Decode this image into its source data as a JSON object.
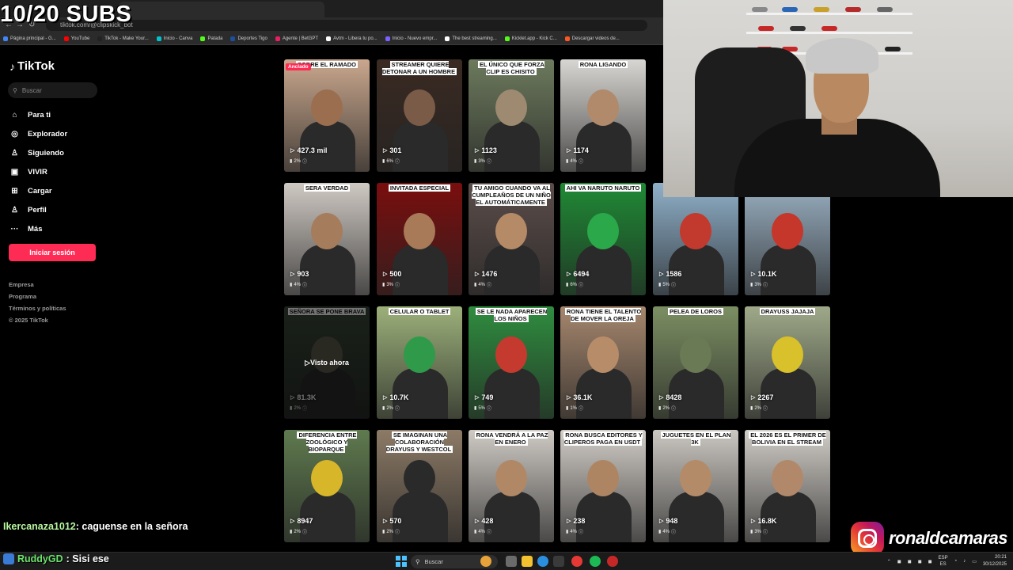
{
  "overlay": {
    "subs": "10/20 SUBS"
  },
  "browser": {
    "url": "tiktok.com/@clipskick_bot",
    "bookmarks": [
      {
        "label": "Página principal - G...",
        "color": "#4285f4"
      },
      {
        "label": "YouTube",
        "color": "#ff0000"
      },
      {
        "label": "TikTok - Make Your...",
        "color": "#222222"
      },
      {
        "label": "Inicio - Canva",
        "color": "#00c4cc"
      },
      {
        "label": "Patada",
        "color": "#53fc18"
      },
      {
        "label": "Deportes Tigo",
        "color": "#1b4fa0"
      },
      {
        "label": "Agente | BetGPT",
        "color": "#e91e63"
      },
      {
        "label": "Avtm - Libera tu po...",
        "color": "#ffffff"
      },
      {
        "label": "Inicio - Nuevo empr...",
        "color": "#7b61ff"
      },
      {
        "label": "The best streaming...",
        "color": "#ffffff"
      },
      {
        "label": "Kicklet.app - Kick C...",
        "color": "#53fc18"
      },
      {
        "label": "Descargar videos de...",
        "color": "#ff5722"
      }
    ]
  },
  "sidebar": {
    "logo": "TikTok",
    "search_placeholder": "Buscar",
    "nav": [
      {
        "label": "Para ti",
        "icon": "home-icon",
        "glyph": "⌂"
      },
      {
        "label": "Explorador",
        "icon": "compass-icon",
        "glyph": "◎"
      },
      {
        "label": "Siguiendo",
        "icon": "user-follow-icon",
        "glyph": "♙"
      },
      {
        "label": "VIVIR",
        "icon": "live-icon",
        "glyph": "▣"
      },
      {
        "label": "Cargar",
        "icon": "upload-icon",
        "glyph": "⊞"
      },
      {
        "label": "Perfil",
        "icon": "profile-icon",
        "glyph": "♙"
      },
      {
        "label": "Más",
        "icon": "more-icon",
        "glyph": "···"
      }
    ],
    "login_label": "Iniciar sesión",
    "footer": [
      "Empresa",
      "Programa",
      "Términos y políticas",
      "© 2025 TikTok"
    ]
  },
  "videos": [
    {
      "caption": "SOBRE EL RAMADO",
      "views": "427.3 mil",
      "pct": "2%",
      "badge": "Anclado",
      "bg": "#c9a78d",
      "face": "#9b6e4f"
    },
    {
      "caption": "STREAMER QUIERE DETONAR A UN HOMBRE",
      "views": "301",
      "pct": "6%",
      "bg": "#3a2a22",
      "face": "#7a5b47"
    },
    {
      "caption": "EL ÚNICO QUE FORZA CLIP ES CHISITO",
      "views": "1123",
      "pct": "3%",
      "bg": "#6d7a5d",
      "face": "#9d8a70"
    },
    {
      "caption": "RONA LIGANDO",
      "views": "1174",
      "pct": "4%",
      "bg": "#d8d6d2",
      "face": "#b08a6b"
    },
    {
      "caption": "SERA VERDAD",
      "views": "903",
      "pct": "4%",
      "bg": "#cfc9c3",
      "face": "#a57c5c"
    },
    {
      "caption": "INVITADA ESPECIAL",
      "views": "500",
      "pct": "3%",
      "bg": "#7a0e0e",
      "face": "#a87a58"
    },
    {
      "caption": "TU AMIGO CUANDO VA AL CUMPLEAÑOS DE UN NIÑO EL AUTOMÁTICAMENTE",
      "views": "1476",
      "pct": "4%",
      "bg": "#5b4d4a",
      "face": "#b58a66"
    },
    {
      "caption": "AHI VA NARUTO NARUTO",
      "views": "6494",
      "pct": "6%",
      "bg": "#1f8a35",
      "face": "#2aa84a"
    },
    {
      "caption": "",
      "views": "1586",
      "pct": "5%",
      "bg": "#8fb0c9",
      "face": "#c23a2e"
    },
    {
      "caption": "",
      "views": "10.1K",
      "pct": "3%",
      "bg": "#9ab0c2",
      "face": "#c4372a"
    },
    {
      "caption": "SEÑORA SE PONE BRAVA",
      "views": "81.3K",
      "pct": "2%",
      "watched": "Visto ahora",
      "bg": "#3b4a3a",
      "face": "#5b5a4a"
    },
    {
      "caption": "CELULAR O TABLET",
      "views": "10.7K",
      "pct": "2%",
      "bg": "#9cb07a",
      "face": "#2f9a4a"
    },
    {
      "caption": "SE LE NADA APARECEN LOS NIÑOS",
      "views": "749",
      "pct": "5%",
      "bg": "#2f8d3f",
      "face": "#c43a2e"
    },
    {
      "caption": "RONA TIENE EL TALENTO DE MOVER LA OREJA",
      "views": "36.1K",
      "pct": "1%",
      "bg": "#a6876e",
      "face": "#b78c69"
    },
    {
      "caption": "PELEA DE LOROS",
      "views": "8428",
      "pct": "2%",
      "bg": "#7c8f63",
      "face": "#6a7a55"
    },
    {
      "caption": "DRAYUSS JAJAJA",
      "views": "2267",
      "pct": "2%",
      "bg": "#9fa989",
      "face": "#d8c12a"
    },
    {
      "caption": "DIFERENCIA ENTRE ZOOLÓGICO Y BIOPARQUE",
      "views": "8947",
      "pct": "2%",
      "bg": "#5f7a4f",
      "face": "#d8b62a"
    },
    {
      "caption": "SE IMAGINAN UNA COLABORACIÓN DRAYUSS Y WESTCOL",
      "views": "570",
      "pct": "2%",
      "bg": "#8c7a66",
      "face": "#2a2a2a"
    },
    {
      "caption": "RONA VENDRÁ A LA PAZ EN ENERO",
      "views": "428",
      "pct": "4%",
      "bg": "#cfcac4",
      "face": "#b08866"
    },
    {
      "caption": "RONA BUSCA EDITORES Y CLIPEROS PAGA EN USDT",
      "views": "238",
      "pct": "4%",
      "bg": "#d2cdc7",
      "face": "#ae8562"
    },
    {
      "caption": "JUGUETES EN EL PLAN 3K",
      "views": "948",
      "pct": "4%",
      "bg": "#cbc7c1",
      "face": "#b38b68"
    },
    {
      "caption": "EL 2026 ES EL PRIMER DE BOLIVIA EN EL STREAM",
      "views": "16.8K",
      "pct": "3%",
      "bg": "#d0ccc6",
      "face": "#b1896a"
    }
  ],
  "chat": {
    "line1_user": "Ikercanaza1012",
    "line1_text": ": caguense en la señora",
    "line2_user": "RuddyGD",
    "line2_text": ": Sisi ese"
  },
  "instagram": {
    "handle": "ronaldcamaras"
  },
  "taskbar": {
    "search_placeholder": "Buscar",
    "lang": "ESP",
    "lang_sub": "ES",
    "time": "20:21",
    "date": "30/12/2025"
  }
}
